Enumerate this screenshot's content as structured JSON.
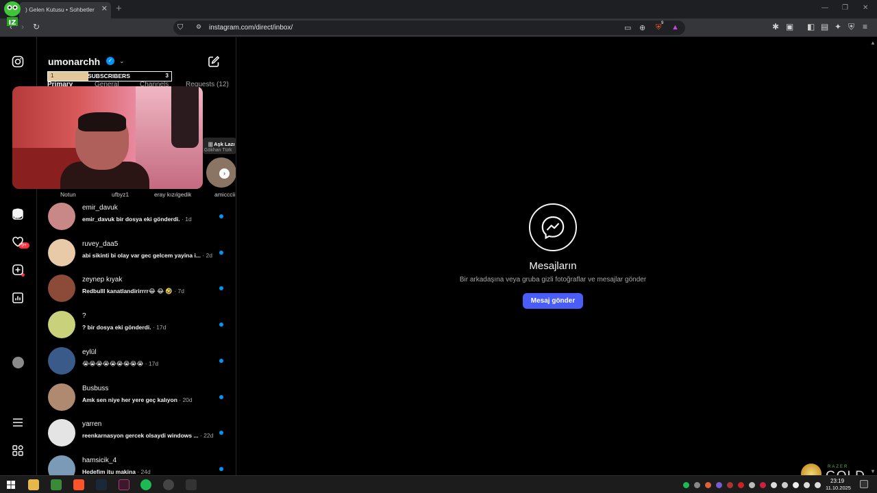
{
  "browser": {
    "tab_title": ") Gelen Kutusu • Sohbetler",
    "tab_close": "✕",
    "new_tab": "+",
    "url": "instagram.com/direct/inbox/",
    "badge_count": "9"
  },
  "sidebar": {
    "notification_badge": "9+"
  },
  "inbox": {
    "username": "umonarchh",
    "subscribers_widget": {
      "left_value": "1",
      "label": "SUBSCRIBERS",
      "right_value": "3",
      "progress_fraction": 0.33
    },
    "tabs": [
      {
        "label": "Primary"
      },
      {
        "label": "General"
      },
      {
        "label": "Channels"
      },
      {
        "label": "Requests (12)"
      }
    ],
    "notes": [
      {
        "name": "Notun"
      },
      {
        "name": "ufbyz1"
      },
      {
        "name": "eray kızılgedik"
      },
      {
        "name": "amicccii"
      }
    ],
    "note_card": {
      "title": "|||  Aşk Lazı",
      "artist": "Gökhan Türk"
    },
    "conversations": [
      {
        "name": "emir_davuk",
        "preview": "emir_davuk bir dosya eki gönderdi.",
        "time": " · 1d",
        "avatar_color": "#c98888"
      },
      {
        "name": "ruvey_daa5",
        "preview": "abi sikinti bi olay var gec gelcem yayina i...",
        "time": " · 2d",
        "avatar_color": "#e8c9a8"
      },
      {
        "name": "zeynep kıyak",
        "preview": "Redbulll kanatlandirirrrr😂 😂 🤣",
        "time": " · 7d",
        "avatar_color": "#8c4a38"
      },
      {
        "name": "?",
        "preview": "? bir dosya eki gönderdi.",
        "time": " · 17d",
        "avatar_color": "#c9d27a"
      },
      {
        "name": "eylül",
        "preview": "😭😭😭😭😭😭😭😭😭",
        "time": " · 17d",
        "avatar_color": "#3a5a8a"
      },
      {
        "name": "Busbuss",
        "preview": "Amk sen niye her yere geç kalıyon",
        "time": " · 20d",
        "avatar_color": "#b08a70"
      },
      {
        "name": "yarren",
        "preview": "reenkarnasyon gercek olsaydi windows ...",
        "time": " · 22d",
        "avatar_color": "#e4e4e4"
      },
      {
        "name": "hamsicik_4",
        "preview": "Hedefim itu makina",
        "time": " · 24d",
        "avatar_color": "#7a9ab8"
      }
    ]
  },
  "main": {
    "title": "Mesajların",
    "subtitle": "Bir arkadaşına veya gruba gizli fotoğraflar ve mesajlar gönder",
    "button_label": "Mesaj gönder"
  },
  "taskbar": {
    "time": "23:19",
    "date": "11.10.2025"
  },
  "watermark": {
    "brand": "RAZER",
    "product": "GOLD"
  },
  "colors": {
    "accent_blue": "#0095f6",
    "button_purple": "#4a5df9",
    "notification_red": "#ff3040"
  }
}
